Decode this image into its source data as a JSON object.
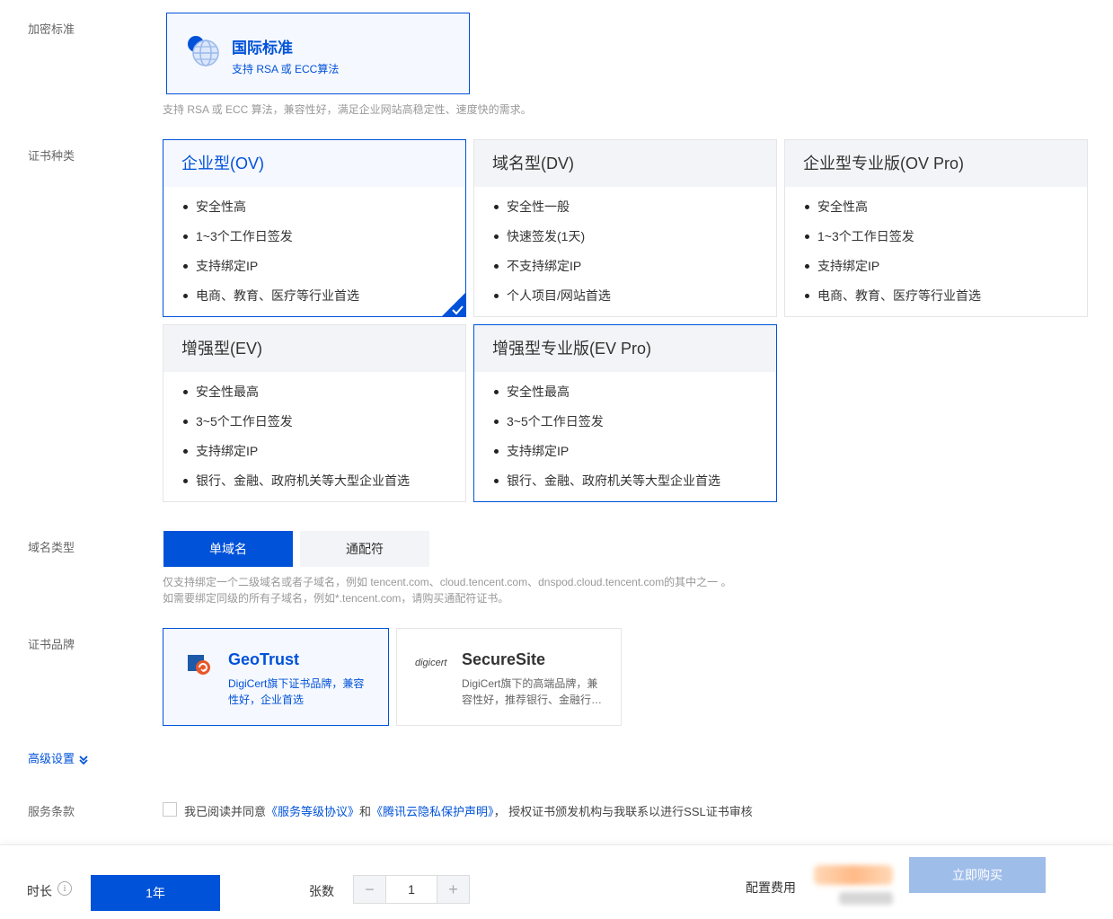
{
  "encryption": {
    "label": "加密标准",
    "card_title": "国际标准",
    "card_sub": "支持 RSA 或 ECC算法",
    "hint": "支持 RSA 或 ECC 算法，兼容性好，满足企业网站高稳定性、速度快的需求。"
  },
  "cert_type": {
    "label": "证书种类",
    "cards": [
      {
        "title": "企业型(OV)",
        "features": [
          "安全性高",
          "1~3个工作日签发",
          "支持绑定IP",
          "电商、教育、医疗等行业首选"
        ],
        "selected": true
      },
      {
        "title": "域名型(DV)",
        "features": [
          "安全性一般",
          "快速签发(1天)",
          "不支持绑定IP",
          "个人项目/网站首选"
        ]
      },
      {
        "title": "企业型专业版(OV Pro)",
        "features": [
          "安全性高",
          "1~3个工作日签发",
          "支持绑定IP",
          "电商、教育、医疗等行业首选"
        ]
      },
      {
        "title": "增强型(EV)",
        "features": [
          "安全性最高",
          "3~5个工作日签发",
          "支持绑定IP",
          "银行、金融、政府机关等大型企业首选"
        ]
      },
      {
        "title": "增强型专业版(EV Pro)",
        "features": [
          "安全性最高",
          "3~5个工作日签发",
          "支持绑定IP",
          "银行、金融、政府机关等大型企业首选"
        ]
      }
    ]
  },
  "domain_type": {
    "label": "域名类型",
    "options": [
      "单域名",
      "通配符"
    ],
    "hint_line1": "仅支持绑定一个二级域名或者子域名，例如 tencent.com、cloud.tencent.com、dnspod.cloud.tencent.com的其中之一 。",
    "hint_line2": "如需要绑定同级的所有子域名，例如*.tencent.com，请购买通配符证书。"
  },
  "brand": {
    "label": "证书品牌",
    "cards": [
      {
        "title": "GeoTrust",
        "desc": "DigiCert旗下证书品牌，兼容性好，企业首选",
        "color": "#0052d9"
      },
      {
        "title": "SecureSite",
        "logo_text": "digicert",
        "desc": "DigiCert旗下的高端品牌，兼容性好，推荐银行、金融行…",
        "color": "#666666"
      }
    ]
  },
  "advanced": {
    "label": "高级设置"
  },
  "terms": {
    "label": "服务条款",
    "prefix": "我已阅读并同意",
    "link1": "《服务等级协议》",
    "mid": "和",
    "link2": "《腾讯云隐私保护声明》",
    "suffix": "， 授权证书颁发机构与我联系以进行SSL证书审核"
  },
  "bottom": {
    "duration_label": "时长",
    "info_icon_glyph": "i",
    "duration_value": "1年",
    "quantity_label": "张数",
    "quantity_value": "1",
    "minus": "−",
    "plus": "+",
    "price_label": "配置费用",
    "buy_label": "立即购买"
  },
  "colors": {
    "primary": "#0052d9",
    "disabled_button": "#9fbde9",
    "geotrust_orange": "#e8582a"
  }
}
